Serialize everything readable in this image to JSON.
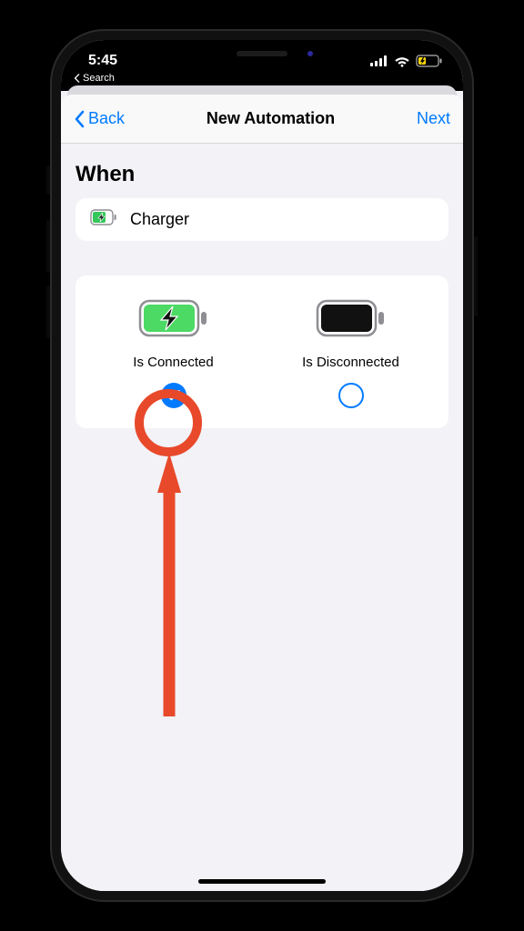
{
  "status": {
    "time": "5:45",
    "back_app": "Search"
  },
  "nav": {
    "back_label": "Back",
    "title": "New Automation",
    "next_label": "Next"
  },
  "section_title": "When",
  "trigger": {
    "label": "Charger"
  },
  "options": {
    "connected_label": "Is Connected",
    "disconnected_label": "Is Disconnected",
    "selected": "connected"
  }
}
